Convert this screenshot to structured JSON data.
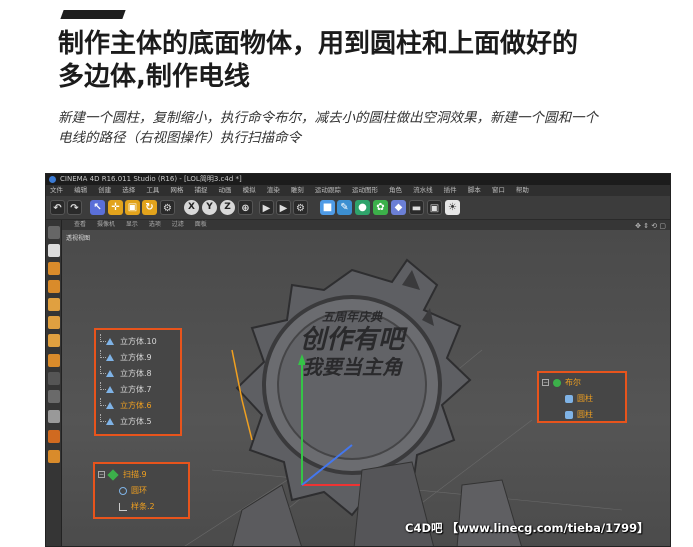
{
  "article": {
    "headline_line1": "制作主体的底面物体，用到圆柱和上面做好的",
    "headline_line2": "多边体,制作电线",
    "subtitle_line1": "新建一个圆柱，复制缩小，执行命令布尔，减去小的圆柱做出空洞效果，新建一个圆和一个",
    "subtitle_line2": "电线的路径（右视图操作）执行扫描命令"
  },
  "app": {
    "title": "CINEMA 4D R16.011 Studio (R16) - [LOL简明3.c4d *]",
    "menu": [
      "文件",
      "编辑",
      "创建",
      "选择",
      "工具",
      "网格",
      "捕捉",
      "动画",
      "模拟",
      "渲染",
      "雕刻",
      "运动跟踪",
      "运动图形",
      "角色",
      "流水线",
      "插件",
      "脚本",
      "窗口",
      "帮助"
    ],
    "toolbar_axes": [
      "X",
      "Y",
      "Z"
    ],
    "viewport_menu": [
      "查看",
      "摄像机",
      "显示",
      "选项",
      "过滤",
      "面板"
    ],
    "viewport_label": "透视视图"
  },
  "panels": {
    "cubes": [
      "立方体.10",
      "立方体.9",
      "立方体.8",
      "立方体.7",
      "立方体.6",
      "立方体.5"
    ],
    "boole": {
      "parent": "布尔",
      "children": [
        "圆柱",
        "圆柱"
      ]
    },
    "sweep": {
      "parent": "扫描.9",
      "children": [
        "圆环",
        "样条.2"
      ]
    }
  },
  "badge": {
    "line1": "五周年庆典",
    "line2": "创作有吧",
    "line3": "我要当主角"
  },
  "watermark": "C4D吧 【www.linecg.com/tieba/1799】",
  "colors": {
    "highlight_border": "#e8541c",
    "selected_text": "#f0a020",
    "cube_icon": "#7fb3e6"
  }
}
